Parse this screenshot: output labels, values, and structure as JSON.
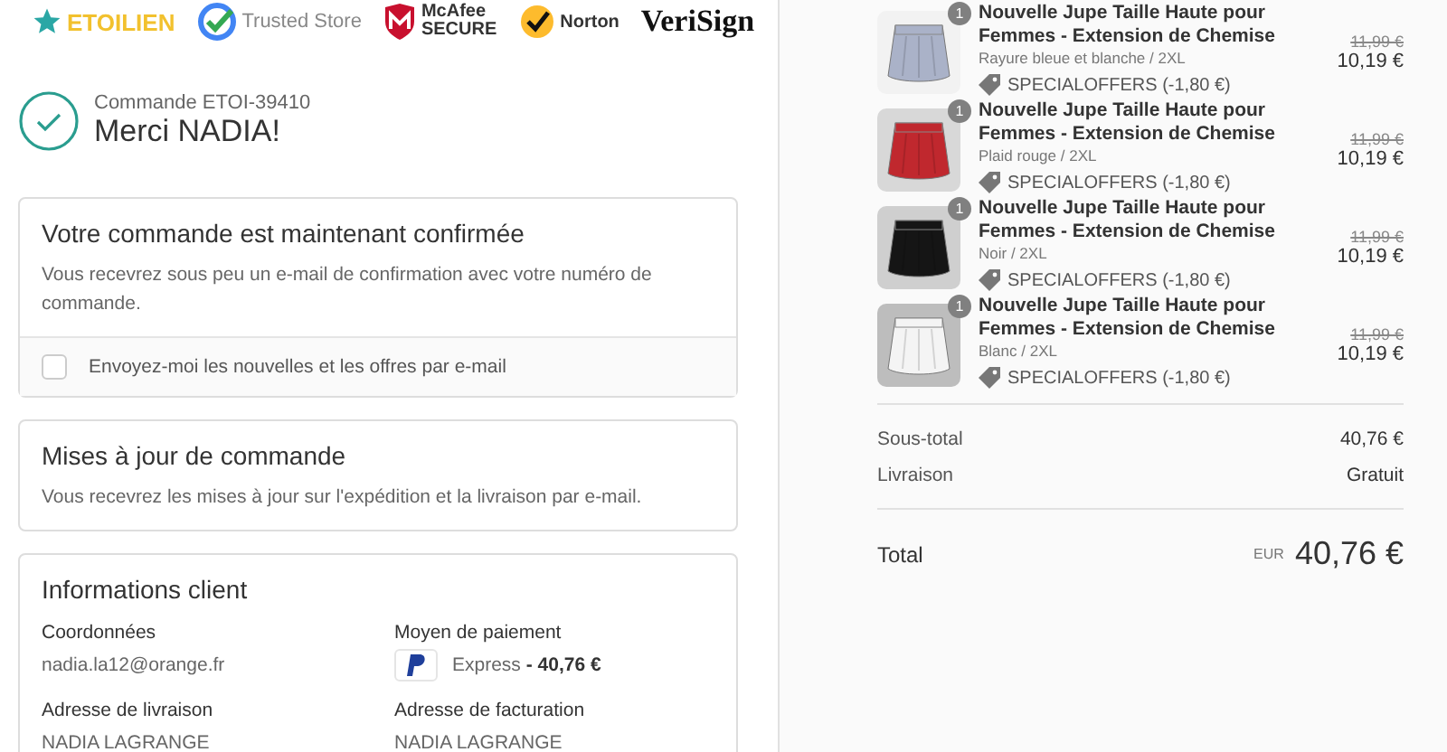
{
  "trust_logos": [
    {
      "kind": "etoilien",
      "texts": [
        "ETOILIEN"
      ]
    },
    {
      "kind": "google",
      "texts": [
        "Trusted Store"
      ]
    },
    {
      "kind": "mcafee",
      "texts": [
        "McAfee",
        "SECURE"
      ]
    },
    {
      "kind": "norton",
      "texts": [
        "Norton"
      ]
    },
    {
      "kind": "verisign",
      "texts": [
        "VeriSign"
      ]
    }
  ],
  "order": {
    "number": "Commande ETOI-39410",
    "thanks": "Merci NADIA!"
  },
  "confirmation": {
    "title": "Votre commande est maintenant confirmée",
    "text": "Vous recevrez sous peu un e-mail de confirmation avec votre numéro de commande.",
    "newsletter": {
      "label": "Envoyez-moi les nouvelles et les offres par e-mail",
      "checked": false
    }
  },
  "updates": {
    "title": "Mises à jour de commande",
    "text": "Vous recevrez les mises à jour sur l'expédition et la livraison par e-mail."
  },
  "customer": {
    "title": "Informations client",
    "contact_label": "Coordonnées",
    "email": "nadia.la12@orange.fr",
    "payment_label": "Moyen de paiement",
    "payment": "Express **- 40,76 €**",
    "shipping_label": "Adresse de livraison",
    "shipping_name": "NADIA LAGRANGE",
    "billing_label": "Adresse de facturation",
    "billing_name": "NADIA LAGRANGE"
  },
  "items": [
    {
      "quantity": "1",
      "title": "Nouvelle Jupe Taille Haute pour Femmes - Extension de Chemise",
      "variant": "Rayure bleue et blanche / 2XL",
      "discount": "SPECIALOFFERS (-1,80 €)",
      "old_price": "11,99 €",
      "price": "10,19 €"
    },
    {
      "quantity": "1",
      "title": "Nouvelle Jupe Taille Haute pour Femmes - Extension de Chemise",
      "variant": "Plaid rouge / 2XL",
      "discount": "SPECIALOFFERS (-1,80 €)",
      "old_price": "11,99 €",
      "price": "10,19 €"
    },
    {
      "quantity": "1",
      "title": "Nouvelle Jupe Taille Haute pour Femmes - Extension de Chemise",
      "variant": "Noir / 2XL",
      "discount": "SPECIALOFFERS (-1,80 €)",
      "old_price": "11,99 €",
      "price": "10,19 €"
    },
    {
      "quantity": "1",
      "title": "Nouvelle Jupe Taille Haute pour Femmes - Extension de Chemise",
      "variant": "Blanc / 2XL",
      "discount": "SPECIALOFFERS (-1,80 €)",
      "old_price": "11,99 €",
      "price": "10,19 €"
    }
  ],
  "summary": [
    {
      "label": "Sous-total",
      "value": "40,76 €"
    },
    {
      "label": "Livraison",
      "value": "Gratuit"
    }
  ],
  "total": {
    "label": "Total",
    "currency": "EUR",
    "value": "40,76 €"
  }
}
